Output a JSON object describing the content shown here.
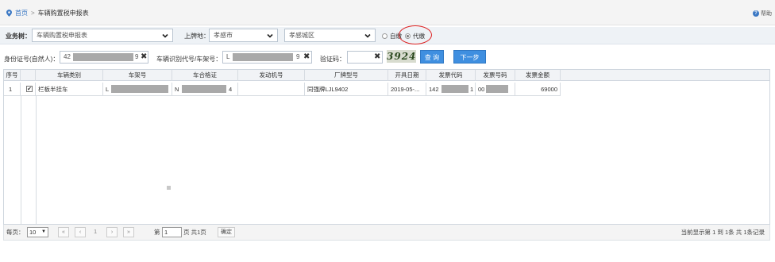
{
  "breadcrumb": {
    "home": "首页",
    "separator": ">",
    "current": "车辆购置税申报表"
  },
  "help": {
    "label": "帮助"
  },
  "filters": {
    "business_type_label": "业务树：",
    "business_type_value": "车辆购置税申报表",
    "plate_region_label": "上牌地：",
    "city_value": "孝感市",
    "district_value": "孝感城区",
    "option_self": "自缴",
    "option_agent": "代缴"
  },
  "search": {
    "id_label": "身份证号(自然人)：",
    "id_value_prefix": "42",
    "id_value_suffix": "9",
    "vin_label": "车辆识别代号/车架号：",
    "vin_value_prefix": "L",
    "vin_value_suffix": "9",
    "captcha_label": "验证码：",
    "captcha_input": "",
    "captcha_image_text": "3924",
    "query_button": "查 询",
    "next_button": "下一步",
    "clear_symbol": "✖"
  },
  "table": {
    "headers": [
      "序号",
      "",
      "车辆类别",
      "车架号",
      "车合格证",
      "发动机号",
      "厂牌型号",
      "开具日期",
      "发票代码",
      "发票号码",
      "发票金额"
    ],
    "rows": [
      {
        "index": "1",
        "checked": "✔",
        "category": "栏板半挂车",
        "frame_prefix": "L",
        "certificate_prefix": "N",
        "certificate_suffix": "4",
        "engine": "",
        "model": "同强牌LJL9402",
        "issue_date": "2019-05-...",
        "invoice_code_prefix": "142",
        "invoice_code_suffix": "1",
        "invoice_no_prefix": "00",
        "amount": "69000"
      }
    ]
  },
  "pager": {
    "per_page_label": "每页：",
    "per_page_value": "10",
    "first": "«",
    "prev": "‹",
    "page_num": "1",
    "next": "›",
    "last": "»",
    "page_prefix": "第",
    "page_input": "1",
    "page_suffix": "页 共1页",
    "confirm": "确定",
    "summary": "当前显示第 1 到 1条 共 1条记录"
  },
  "colors": {
    "primary_button": "#3f8fe0",
    "annotation_circle": "#dd2222",
    "mask": "#a9a9a9"
  }
}
